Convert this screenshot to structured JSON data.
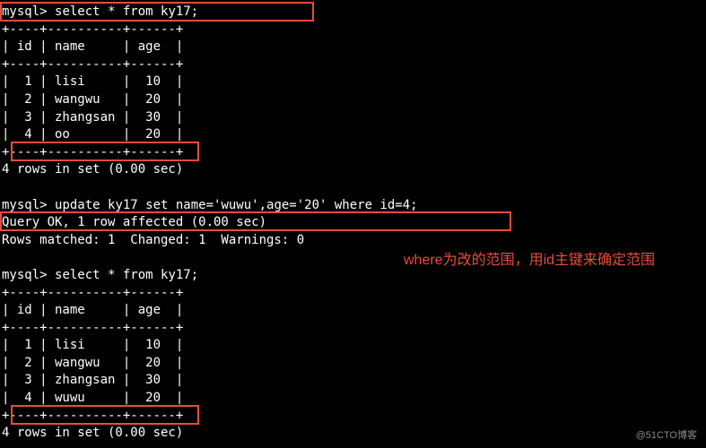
{
  "prompt": "mysql>",
  "commands": {
    "select1": "select * from ky17;",
    "update": "update ky17 set name='wuwu',age='20' where id=4;",
    "select2": "select * from ky17;"
  },
  "table1": {
    "sep": "+----+----------+------+",
    "header": "| id | name     | age  |",
    "rows": [
      "|  1 | lisi     |  10  |",
      "|  2 | wangwu   |  20  |",
      "|  3 | zhangsan |  30  |",
      "|  4 | oo       |  20  |"
    ]
  },
  "result1": "4 rows in set (0.00 sec)",
  "update_result": {
    "l1": "Query OK, 1 row affected (0.00 sec)",
    "l2": "Rows matched: 1  Changed: 1  Warnings: 0"
  },
  "table2": {
    "sep": "+----+----------+------+",
    "header": "| id | name     | age  |",
    "rows": [
      "|  1 | lisi     |  10  |",
      "|  2 | wangwu   |  20  |",
      "|  3 | zhangsan |  30  |",
      "|  4 | wuwu     |  20  |"
    ]
  },
  "result2": "4 rows in set (0.00 sec)",
  "annotation": "where为改的范围，用id主键来确定范围",
  "watermark": "@51CTO博客",
  "chart_data": {
    "type": "table",
    "note": "MySQL terminal session showing SELECT and UPDATE on table ky17",
    "before_update": {
      "columns": [
        "id",
        "name",
        "age"
      ],
      "rows": [
        {
          "id": 1,
          "name": "lisi",
          "age": 10
        },
        {
          "id": 2,
          "name": "wangwu",
          "age": 20
        },
        {
          "id": 3,
          "name": "zhangsan",
          "age": 30
        },
        {
          "id": 4,
          "name": "oo",
          "age": 20
        }
      ]
    },
    "update_statement": "update ky17 set name='wuwu',age='20' where id=4;",
    "after_update": {
      "columns": [
        "id",
        "name",
        "age"
      ],
      "rows": [
        {
          "id": 1,
          "name": "lisi",
          "age": 10
        },
        {
          "id": 2,
          "name": "wangwu",
          "age": 20
        },
        {
          "id": 3,
          "name": "zhangsan",
          "age": 30
        },
        {
          "id": 4,
          "name": "wuwu",
          "age": 20
        }
      ]
    }
  }
}
